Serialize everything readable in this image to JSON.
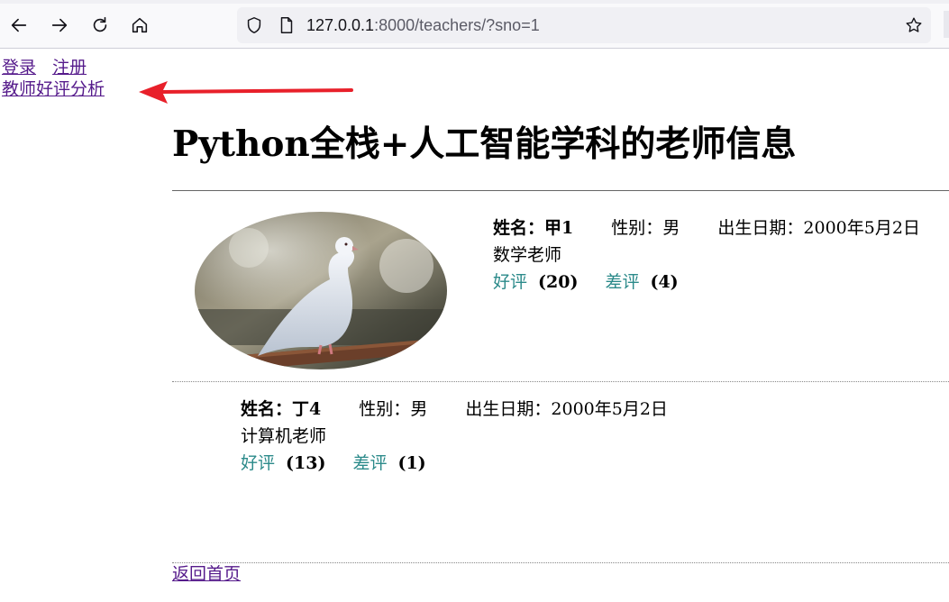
{
  "browser": {
    "url_host": "127.0.0.1",
    "url_rest": ":8000/teachers/?sno=1"
  },
  "nav": {
    "login": "登录",
    "register": "注册",
    "analysis": "教师好评分析"
  },
  "page_title": "Python全栈+人工智能学科的老师信息",
  "labels": {
    "name": "姓名：",
    "gender": "性别：",
    "birth": "出生日期：",
    "good": "好评",
    "bad": "差评"
  },
  "teachers": [
    {
      "name": "甲1",
      "gender": "男",
      "birth": "2000年5月2日",
      "intro": "数学老师",
      "good_count": "(20)",
      "bad_count": "(4)"
    },
    {
      "name": "丁4",
      "gender": "男",
      "birth": "2000年5月2日",
      "intro": "计算机老师",
      "good_count": "(13)",
      "bad_count": "(1)"
    }
  ],
  "back_link": "返回首页",
  "colors": {
    "link_visited": "#551a8b",
    "vote_link": "#2b8a8a",
    "annotation_arrow": "#e8202a"
  },
  "icons": [
    "back-arrow-icon",
    "forward-arrow-icon",
    "reload-icon",
    "home-icon",
    "shield-icon",
    "page-icon",
    "star-icon"
  ]
}
